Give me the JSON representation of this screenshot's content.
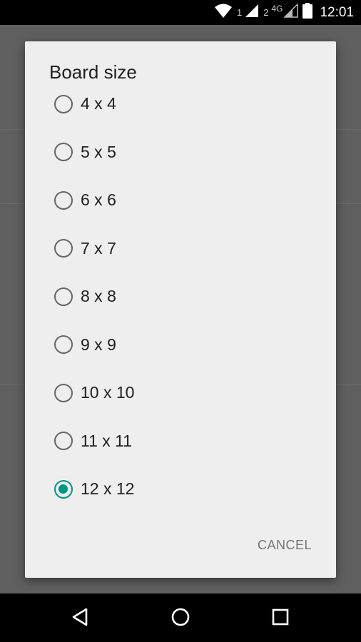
{
  "status_bar": {
    "sim1": "1",
    "sim2": "2",
    "network": "4G",
    "time": "12:01"
  },
  "dialog": {
    "title": "Board size",
    "options": [
      {
        "label": "4 x 4",
        "checked": false
      },
      {
        "label": "5 x 5",
        "checked": false
      },
      {
        "label": "6 x 6",
        "checked": false
      },
      {
        "label": "7 x 7",
        "checked": false
      },
      {
        "label": "8 x 8",
        "checked": false
      },
      {
        "label": "9 x 9",
        "checked": false
      },
      {
        "label": "10 x 10",
        "checked": false
      },
      {
        "label": "11 x 11",
        "checked": false
      },
      {
        "label": "12 x 12",
        "checked": true
      }
    ],
    "cancel_label": "CANCEL"
  },
  "nav_bar": {
    "back_icon": "back-triangle",
    "home_icon": "home-circle",
    "recents_icon": "recents-square"
  },
  "colors": {
    "accent": "#009688",
    "dialog_bg": "#eeeeee",
    "scrim": "#5f5f5f"
  }
}
